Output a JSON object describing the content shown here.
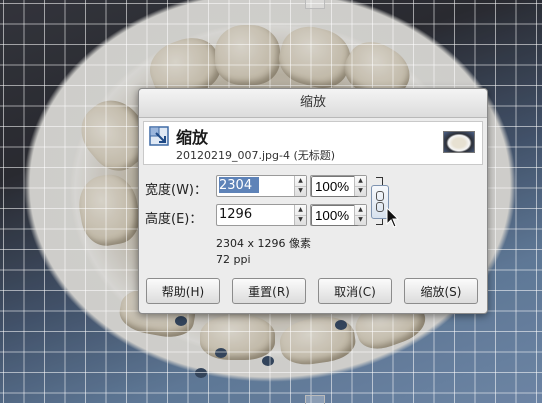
{
  "dialog": {
    "window_title": "缩放",
    "header_title": "缩放",
    "header_subtitle": "20120219_007.jpg-4 (无标题)"
  },
  "width": {
    "label": "宽度(W)：",
    "value": "2304",
    "percent": "100%"
  },
  "height": {
    "label": "高度(E)：",
    "value": "1296",
    "percent": "100%"
  },
  "info": {
    "size": "2304 x 1296 像素",
    "resolution": "72 ppi"
  },
  "buttons": {
    "help": "帮助(H)",
    "reset": "重置(R)",
    "cancel": "取消(C)",
    "scale": "缩放(S)"
  },
  "icons": [
    "scale-icon",
    "image-thumbnail",
    "chain-link-icon",
    "mouse-cursor-icon"
  ],
  "colors": {
    "selection": "#5e83b8",
    "chain_border": "#7f94b1"
  }
}
